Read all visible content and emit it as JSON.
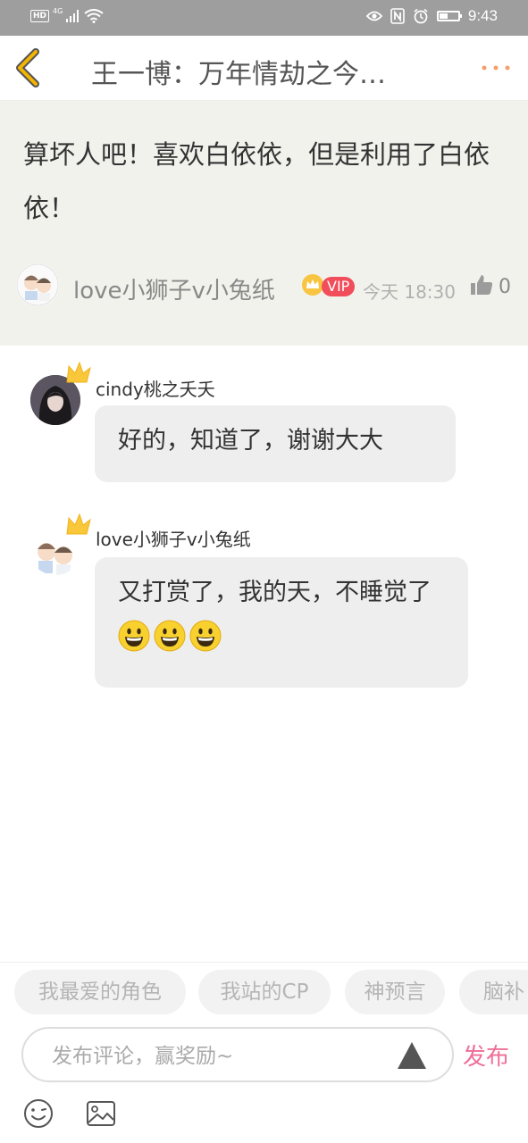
{
  "status_bar": {
    "hd": "HD",
    "network": "4G",
    "time": "9:43",
    "battery_level": 0.45,
    "icons": [
      "signal-icon",
      "wifi-icon",
      "eye-icon",
      "nfc-icon",
      "alarm-icon",
      "battery-icon"
    ]
  },
  "header": {
    "title": "王一博：万年情劫之今…",
    "back_icon": "chevron-left-icon",
    "more_icon": "more-dots-icon",
    "accent": "#f5b400",
    "more_color": "#f3a06a"
  },
  "original_comment": {
    "text": "算坏人吧！喜欢白依依，但是利用了白依依！",
    "author": "love小狮子v小兔纸",
    "vip_label": "VIP",
    "time": "今天 18:30",
    "like_count": "0",
    "background": "#f2f2ed"
  },
  "replies": [
    {
      "name": "cindy桃之夭夭",
      "text": "好的，知道了，谢谢大大",
      "emoji_count": 0
    },
    {
      "name": "love小狮子v小兔纸",
      "text": "又打赏了，我的天，不睡觉了",
      "emoji_count": 3
    }
  ],
  "tags": [
    "我最爱的角色",
    "我站的CP",
    "神预言",
    "脑补"
  ],
  "comment_bar": {
    "placeholder": "发布评论，赢奖励~",
    "publish_label": "发布",
    "publish_color": "#ee6f98"
  }
}
